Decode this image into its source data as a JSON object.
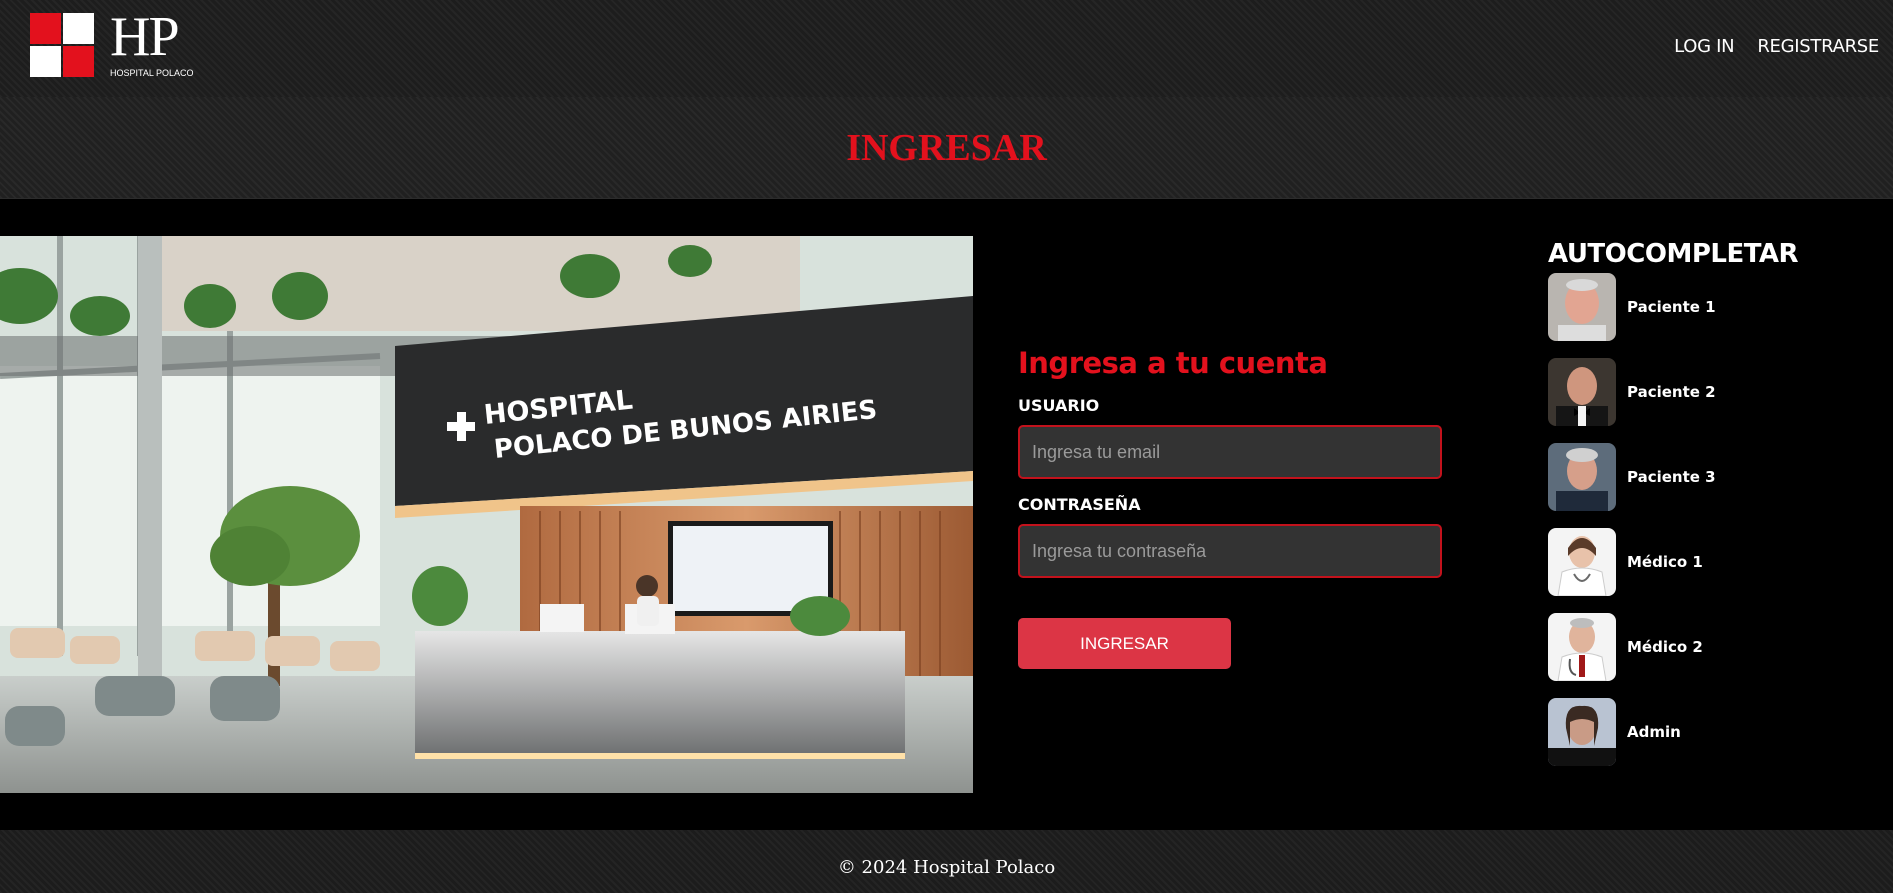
{
  "header": {
    "logo_letters": "HP",
    "logo_subtitle": "HOSPITAL POLACO",
    "nav": [
      {
        "label": "LOG IN"
      },
      {
        "label": "REGISTRARSE"
      }
    ]
  },
  "page_title": "INGRESAR",
  "hero_image": {
    "sign_line1": "HOSPITAL",
    "sign_line2": "POLACO DE BUNOS AIRIES"
  },
  "login_form": {
    "heading": "Ingresa a tu cuenta",
    "user_label": "USUARIO",
    "user_placeholder": "Ingresa tu email",
    "password_label": "CONTRASEÑA",
    "password_placeholder": "Ingresa tu contraseña",
    "submit_label": "INGRESAR"
  },
  "autocomplete": {
    "title": "AUTOCOMPLETAR",
    "items": [
      {
        "label": "Paciente 1"
      },
      {
        "label": "Paciente 2"
      },
      {
        "label": "Paciente 3"
      },
      {
        "label": "Médico 1"
      },
      {
        "label": "Médico 2"
      },
      {
        "label": "Admin"
      }
    ]
  },
  "footer": {
    "copyright": "© 2024 Hospital Polaco"
  },
  "colors": {
    "accent_red": "#e3111d",
    "button_red": "#dc3545",
    "input_bg": "#333333"
  }
}
